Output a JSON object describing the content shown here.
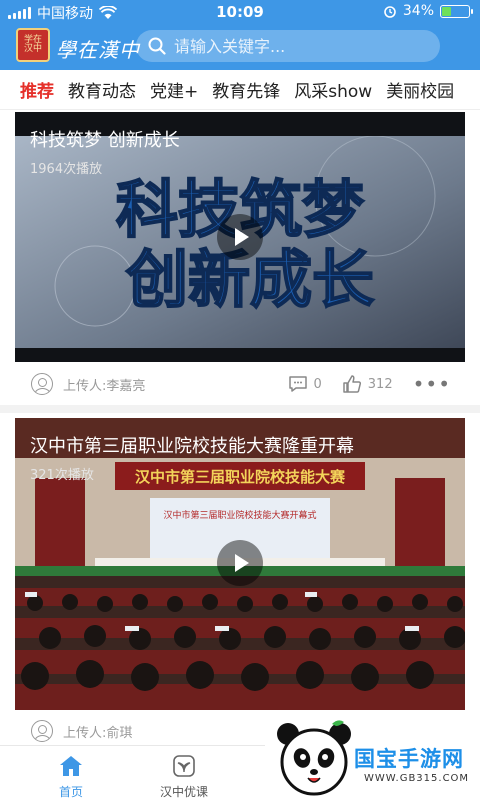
{
  "status_bar": {
    "carrier": "中国移动",
    "time": "10:09",
    "battery_percent": "34%",
    "battery_level": 0.34
  },
  "header": {
    "logo_text": "学在汉中",
    "brand_title": "學在漢中",
    "search_placeholder": "请输入关键字...",
    "accent_color": "#3e97e6"
  },
  "tabs": [
    {
      "label": "推荐",
      "active": true
    },
    {
      "label": "教育动态"
    },
    {
      "label": "党建+"
    },
    {
      "label": "教育先锋"
    },
    {
      "label": "风采show"
    },
    {
      "label": "美丽校园"
    }
  ],
  "videos": [
    {
      "title": "科技筑梦 创新成长",
      "plays": "1964次播放",
      "thumbnail_text_line1": "科技筑梦",
      "thumbnail_text_line2": "创新成长",
      "uploader": "上传人:李嘉亮",
      "comments": "0",
      "likes": "312"
    },
    {
      "title": "汉中市第三届职业院校技能大赛隆重开幕",
      "plays": "321次播放",
      "stage_banner": "汉中市第三届职业院校技能大赛",
      "stage_screen": "汉中市第三届职业院校技能大赛开幕式",
      "uploader": "上传人:俞琪"
    }
  ],
  "bottom_nav": [
    {
      "label": "首页",
      "icon": "home-icon",
      "active": true
    },
    {
      "label": "汉中优课",
      "icon": "leaf-icon"
    }
  ],
  "watermark": {
    "title": "国宝手游网",
    "url": "WWW.GB315.COM"
  }
}
